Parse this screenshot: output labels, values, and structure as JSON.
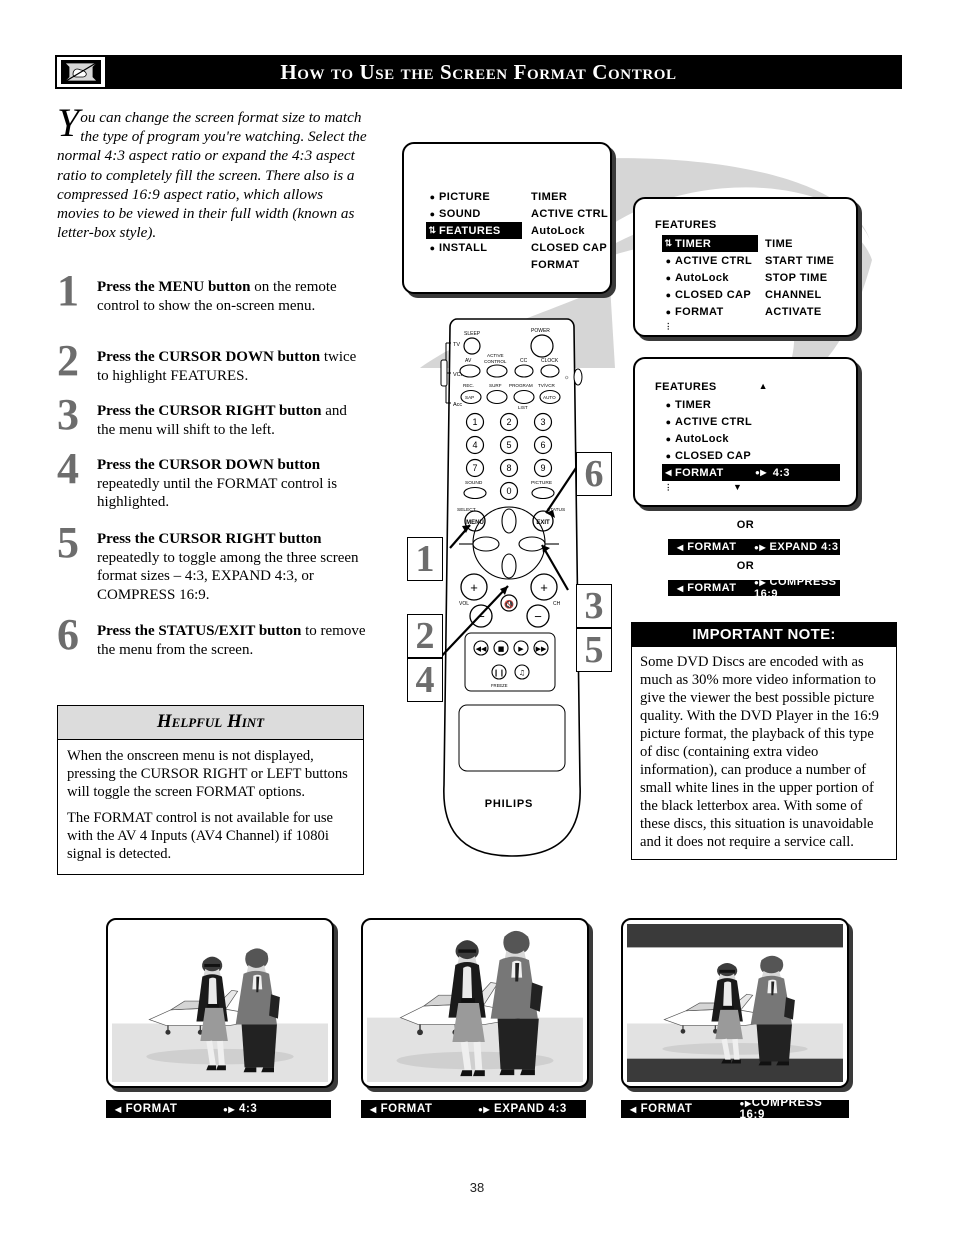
{
  "header": {
    "title": "How to Use the Screen Format Control",
    "icon": "tv-no-hand-icon"
  },
  "intro": {
    "dropcap": "Y",
    "text": "ou can change the screen format size to match the type of program you're watching. Select the normal 4:3 aspect ratio or expand the 4:3 aspect ratio to completely fill the screen. There also is a compressed 16:9 aspect ratio, which allows movies to be viewed in their full width (known as letter-box style)."
  },
  "steps": [
    {
      "num": "1",
      "bold": "Press the MENU button",
      "rest": " on the remote control to show the on-screen menu."
    },
    {
      "num": "2",
      "bold": "Press the CURSOR DOWN button",
      "rest": " twice to highlight FEATURES."
    },
    {
      "num": "3",
      "bold": "Press the CURSOR RIGHT button",
      "rest": " and the menu will shift to the left."
    },
    {
      "num": "4",
      "bold": "Press the CURSOR DOWN button",
      "rest": " repeatedly until the FORMAT control is highlighted."
    },
    {
      "num": "5",
      "bold": "Press the CURSOR RIGHT button",
      "rest": " repeatedly to toggle among the three screen format sizes – 4:3, EXPAND 4:3, or COMPRESS 16:9."
    },
    {
      "num": "6",
      "bold": "Press the STATUS/EXIT button",
      "rest": " to remove the menu from the screen."
    }
  ],
  "hint": {
    "title": "Helpful Hint",
    "paragraphs": [
      "When the onscreen menu is not displayed, pressing the CURSOR RIGHT or LEFT buttons will toggle the screen FORMAT options.",
      "The FORMAT control is not available for use with the AV 4 Inputs (AV4 Channel) if 1080i signal is detected."
    ]
  },
  "menu1": {
    "left_items": [
      {
        "label": "PICTURE",
        "marker": "bullet",
        "highlighted": false
      },
      {
        "label": "SOUND",
        "marker": "bullet",
        "highlighted": false
      },
      {
        "label": "FEATURES",
        "marker": "updown",
        "highlighted": true
      },
      {
        "label": "INSTALL",
        "marker": "bullet",
        "highlighted": false
      }
    ],
    "right_items": [
      "TIMER",
      "ACTIVE CTRL",
      "AutoLock",
      "CLOSED CAP",
      "FORMAT"
    ]
  },
  "menu2": {
    "title": "FEATURES",
    "left_items": [
      {
        "label": "TIMER",
        "marker": "updown",
        "highlighted": true
      },
      {
        "label": "ACTIVE CTRL",
        "marker": "bullet",
        "highlighted": false
      },
      {
        "label": "AutoLock",
        "marker": "bullet",
        "highlighted": false
      },
      {
        "label": "CLOSED CAP",
        "marker": "bullet",
        "highlighted": false
      },
      {
        "label": "FORMAT",
        "marker": "bullet",
        "highlighted": false
      },
      {
        "label": "",
        "marker": "down",
        "highlighted": false
      }
    ],
    "right_items": [
      "TIME",
      "START TIME",
      "STOP TIME",
      "CHANNEL",
      "ACTIVATE"
    ]
  },
  "menu3": {
    "title": "FEATURES",
    "up_arrow": "▲",
    "down_arrow": "▼",
    "items": [
      {
        "label": "TIMER",
        "marker": "bullet",
        "value": "",
        "highlighted": false
      },
      {
        "label": "ACTIVE CTRL",
        "marker": "bullet",
        "value": "",
        "highlighted": false
      },
      {
        "label": "AutoLock",
        "marker": "bullet",
        "value": "",
        "highlighted": false
      },
      {
        "label": "CLOSED CAP",
        "marker": "bullet",
        "value": "",
        "highlighted": false
      },
      {
        "label": "FORMAT",
        "marker": "left",
        "value": "4:3",
        "highlighted": true
      }
    ]
  },
  "alternatives": {
    "or_label_1": "OR",
    "or_label_2": "OR",
    "bar1": {
      "left": "FORMAT",
      "right": "EXPAND 4:3"
    },
    "bar2": {
      "left": "FORMAT",
      "right": "COMPRESS 16:9"
    }
  },
  "note": {
    "title": "IMPORTANT NOTE:",
    "body": "Some DVD Discs are encoded with as much as 30% more video information to give the viewer the best possible picture quality. With the DVD Player in the 16:9 picture format, the playback of this type of disc (containing extra video information), can produce a number of small white lines in the upper portion of the black letterbox area. With some of these discs, this situation is unavoidable and it does not require a service call."
  },
  "remote": {
    "brand": "PHILIPS",
    "mode_labels": [
      "TV",
      "VCR",
      "Acc"
    ],
    "buttons": [
      "SLEEP",
      "POWER",
      "AV",
      "ACTIVE CONTROL",
      "CC",
      "CLOCK",
      "REC. SAP",
      "SURF",
      "PROGRAM LIST",
      "TV/VCR AUTO",
      "1",
      "2",
      "3",
      "4",
      "5",
      "6",
      "7",
      "8",
      "9",
      "0",
      "SOUND",
      "PICTURE",
      "MENU",
      "SELECT",
      "EXIT",
      "STATUS",
      "VOL",
      "CH",
      "MUTE",
      "FREEZE"
    ],
    "transport": [
      "rewind-icon",
      "stop-icon",
      "play-icon",
      "fast-forward-icon",
      "pause-icon",
      "surround-icon"
    ]
  },
  "callouts": [
    {
      "num": "1"
    },
    {
      "num": "2"
    },
    {
      "num": "3"
    },
    {
      "num": "4"
    },
    {
      "num": "5"
    },
    {
      "num": "6"
    }
  ],
  "examples": [
    {
      "id": "normal",
      "left": "FORMAT",
      "right": "4:3",
      "letterbox": false
    },
    {
      "id": "expand",
      "left": "FORMAT",
      "right": "EXPAND 4:3",
      "letterbox": false
    },
    {
      "id": "compress",
      "left": "FORMAT",
      "right": "COMPRESS 16:9",
      "letterbox": true
    }
  ],
  "page_number": "38",
  "colors": {
    "osd_highlight": "#000000",
    "step_number": "#6d6d6d",
    "hint_header": "#dcdcdc",
    "swoosh": "#d6d6d6"
  }
}
